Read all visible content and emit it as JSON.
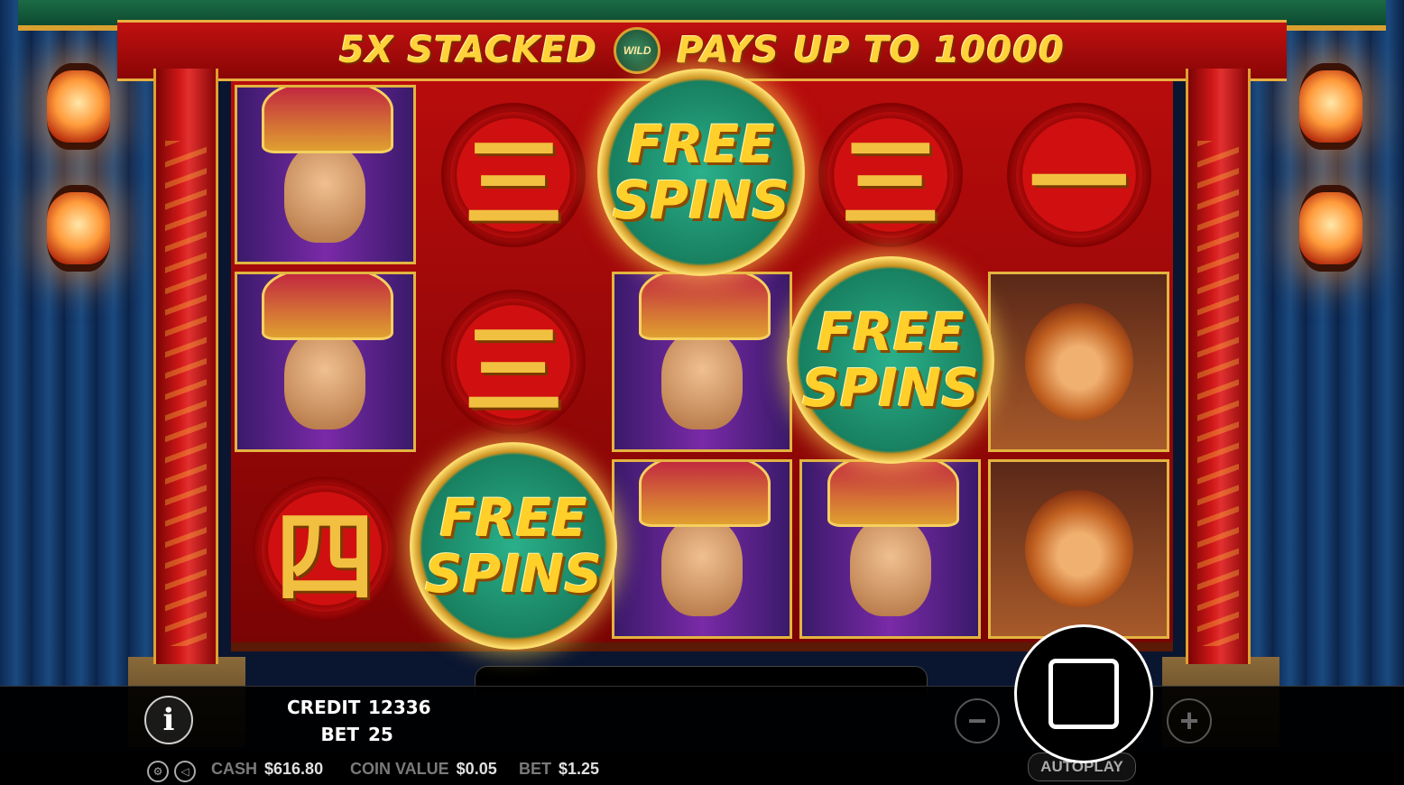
{
  "banner": {
    "left_text": "5X STACKED",
    "wild_label": "WILD",
    "right_text": "PAYS UP TO 10000"
  },
  "reels": {
    "symbols": {
      "three": "三",
      "one": "一",
      "four": "四"
    },
    "free_spins_line1": "FREE",
    "free_spins_line2": "SPINS"
  },
  "panel": {
    "credit_label": "CREDIT",
    "credit_value": "12336",
    "bet_label": "BET",
    "bet_value": "25"
  },
  "controls": {
    "info": "i",
    "minus": "−",
    "plus": "+",
    "autoplay": "AUTOPLAY"
  },
  "footer": {
    "cash_label": "CASH",
    "cash_value": "$616.80",
    "coin_value_label": "COIN VALUE",
    "coin_value": "$0.05",
    "bet_label": "BET",
    "bet_value": "$1.25"
  },
  "colors": {
    "gold": "#ffd23a",
    "reel_red": "#b80c0c",
    "free_spins_green": "#188060"
  }
}
